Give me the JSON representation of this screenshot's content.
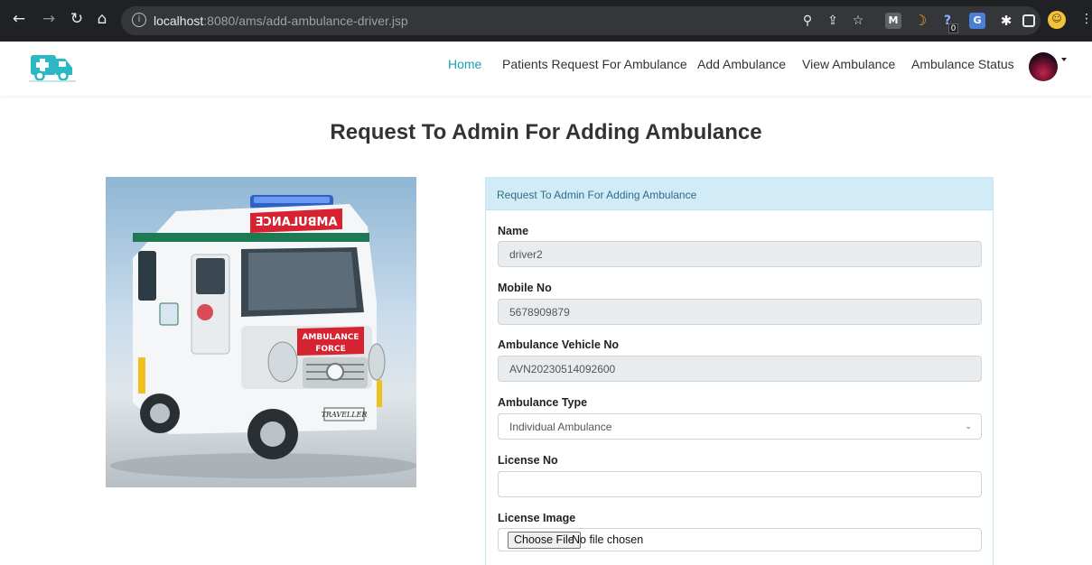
{
  "browser": {
    "url_host": "localhost",
    "url_path": ":8080/ams/add-ambulance-driver.jsp",
    "back_icon": "arrow-left-icon",
    "forward_icon": "arrow-right-icon",
    "reload_icon": "reload-icon",
    "home_icon": "home-icon",
    "ext_badge": "0"
  },
  "nav": {
    "links": [
      {
        "label": "Home",
        "active": true
      },
      {
        "label": "Patients Request For Ambulance",
        "active": false
      },
      {
        "label": "Add Ambulance",
        "active": false
      },
      {
        "label": "View Ambulance",
        "active": false
      },
      {
        "label": "Ambulance Status",
        "active": false
      }
    ],
    "accent_color": "#17a2b8"
  },
  "page": {
    "title": "Request To Admin For Adding Ambulance"
  },
  "vehicle_image": {
    "front_sign": "AMBULANCE",
    "reversed_sign": "ƎƆИA⅃UꓭMA",
    "brand": "FORCE",
    "model": "TRAVELLER"
  },
  "form": {
    "header": "Request To Admin For Adding Ambulance",
    "name_label": "Name",
    "name_value": "driver2",
    "mobile_label": "Mobile No",
    "mobile_value": "5678909879",
    "vehicle_label": "Ambulance Vehicle No",
    "vehicle_value": "AVN20230514092600",
    "type_label": "Ambulance Type",
    "type_value": "Individual Ambulance",
    "license_label": "License No",
    "license_value": "",
    "license_image_label": "License Image",
    "choose_file": "Choose File",
    "file_status": "No file chosen"
  }
}
